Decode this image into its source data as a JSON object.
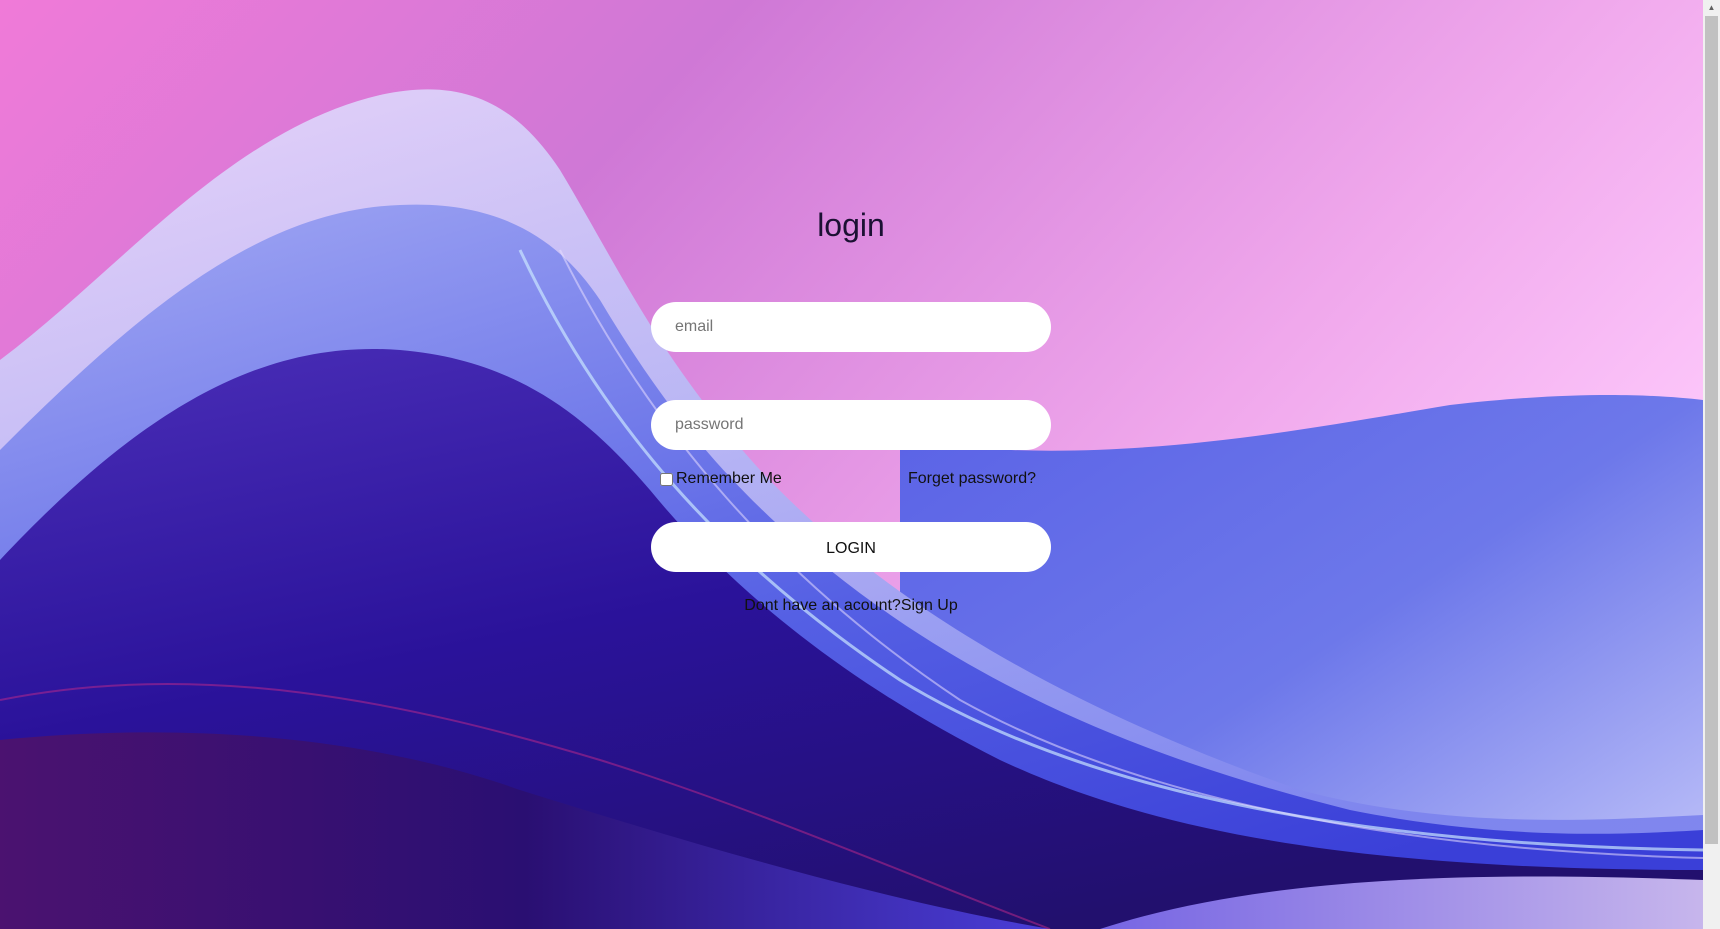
{
  "login": {
    "title": "login",
    "email_placeholder": "email",
    "password_placeholder": "password",
    "remember_label": "Remember Me",
    "remember_checked": false,
    "forget_label": "Forget password?",
    "button_label": "LOGIN",
    "signup_prompt": "Dont have an acount?",
    "signup_link": "Sign Up"
  },
  "colors": {
    "field_background": "#ffffff",
    "text": "#111111",
    "background_top": "#d97bd8",
    "background_wave": "#3b3bd6",
    "background_deep": "#2a0f6e"
  },
  "icons": {
    "scroll_up": "chevron-up-icon",
    "background": "abstract-wave-background"
  }
}
